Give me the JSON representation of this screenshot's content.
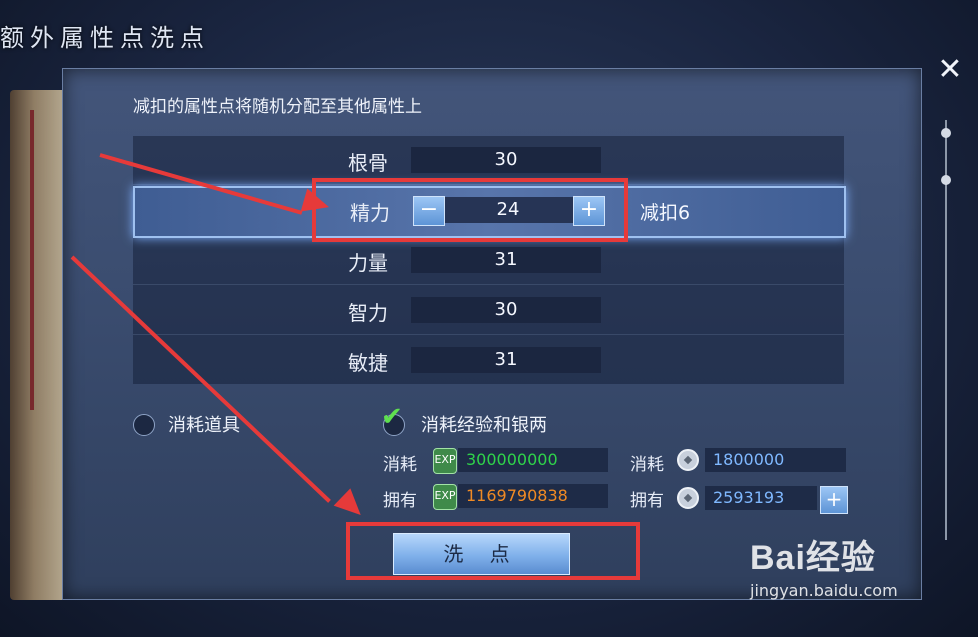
{
  "window": {
    "title": "额外属性点洗点"
  },
  "panel": {
    "notice": "减扣的属性点将随机分配至其他属性上",
    "attributes": [
      {
        "label": "根骨",
        "value": "30"
      },
      {
        "label": "精力",
        "value": "24",
        "selected": true,
        "deduct": "减扣6"
      },
      {
        "label": "力量",
        "value": "31"
      },
      {
        "label": "智力",
        "value": "30"
      },
      {
        "label": "敏捷",
        "value": "31"
      }
    ],
    "stepper": {
      "minus": "−",
      "plus": "+"
    },
    "options": {
      "consume_item": {
        "label": "消耗道具",
        "selected": false
      },
      "consume_exp_silver": {
        "label": "消耗经验和银两",
        "selected": true
      }
    },
    "costs": {
      "exp": {
        "consume_label": "消耗",
        "consume_value": "300000000",
        "own_label": "拥有",
        "own_value": "1169790838",
        "icon": "exp-icon"
      },
      "silver": {
        "consume_label": "消耗",
        "consume_value": "1800000",
        "own_label": "拥有",
        "own_value": "2593193",
        "icon": "coin-icon",
        "add": "+"
      }
    },
    "wash_button": "洗 点"
  },
  "close_icon": "✕",
  "colors": {
    "accent": "#9fc1f0",
    "highlight": "#e63a3a",
    "exp_green": "#2fd34a",
    "own_orange": "#f08a24",
    "silver_blue": "#7fb8ff"
  },
  "watermark": {
    "brand": "Bai经验",
    "url": "jingyan.baidu.com"
  }
}
